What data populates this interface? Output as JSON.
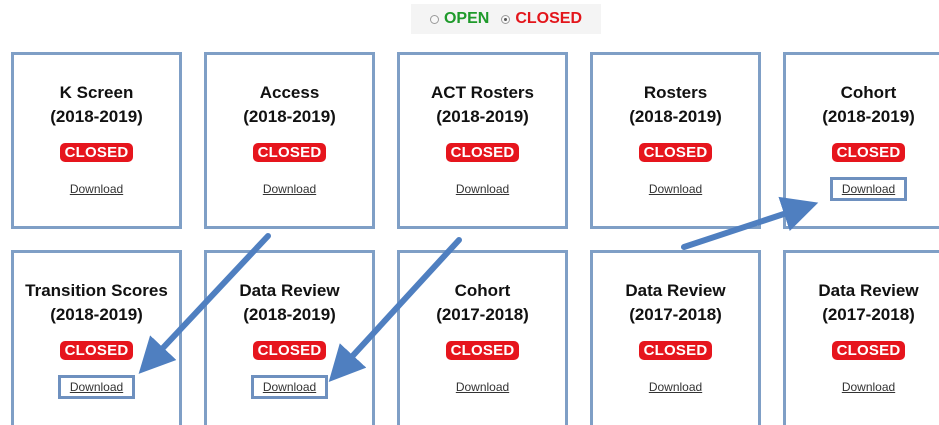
{
  "legend": {
    "open_label": "OPEN",
    "closed_label": "CLOSED",
    "selected": "closed"
  },
  "colors": {
    "card_border": "#7f9fc6",
    "closed_badge": "#e6151d",
    "open_text": "#1f9a2b",
    "closed_text": "#e3151b",
    "arrow": "#4f7fc0"
  },
  "cards": [
    {
      "title": "K Screen",
      "year": "(2018-2019)",
      "status": "CLOSED",
      "download": "Download"
    },
    {
      "title": "Access",
      "year": "(2018-2019)",
      "status": "CLOSED",
      "download": "Download"
    },
    {
      "title": "ACT Rosters",
      "year": "(2018-2019)",
      "status": "CLOSED",
      "download": "Download"
    },
    {
      "title": "Rosters",
      "year": "(2018-2019)",
      "status": "CLOSED",
      "download": "Download"
    },
    {
      "title": "Cohort",
      "year": "(2018-2019)",
      "status": "CLOSED",
      "download": "Download"
    },
    {
      "title": "Transition Scores",
      "year": "(2018-2019)",
      "status": "CLOSED",
      "download": "Download"
    },
    {
      "title": "Data Review",
      "year": "(2018-2019)",
      "status": "CLOSED",
      "download": "Download"
    },
    {
      "title": "Cohort",
      "year": "(2017-2018)",
      "status": "CLOSED",
      "download": "Download"
    },
    {
      "title": "Data Review",
      "year": "(2017-2018)",
      "status": "CLOSED",
      "download": "Download"
    },
    {
      "title": "Data Review",
      "year": "(2017-2018)",
      "status": "CLOSED",
      "download": "Download"
    }
  ]
}
